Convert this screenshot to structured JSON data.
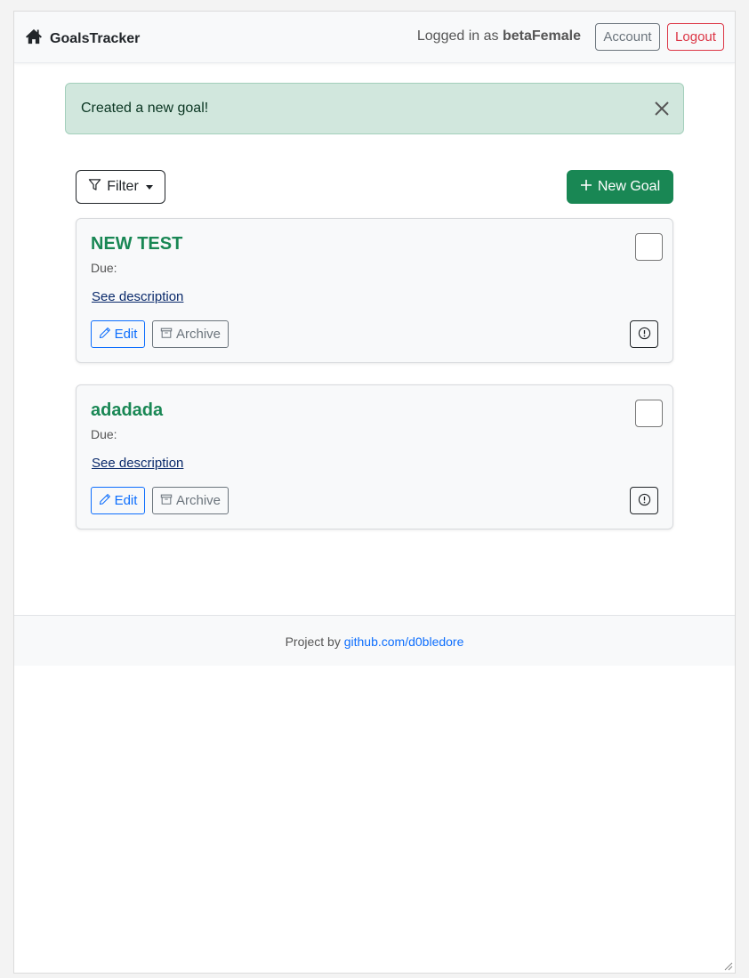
{
  "navbar": {
    "brand": "GoalsTracker",
    "logged_in_prefix": "Logged in as ",
    "username": "betaFemale",
    "account_label": "Account",
    "logout_label": "Logout"
  },
  "alert": {
    "message": "Created a new goal!"
  },
  "toolbar": {
    "filter_label": "Filter",
    "new_goal_label": "New Goal"
  },
  "goals": [
    {
      "title": "NEW TEST",
      "due_label": "Due:",
      "link_label": "See description",
      "edit_label": "Edit",
      "archive_label": "Archive"
    },
    {
      "title": "adadada",
      "due_label": "Due:",
      "link_label": "See description",
      "edit_label": "Edit",
      "archive_label": "Archive"
    }
  ],
  "footer": {
    "prefix": "Project by ",
    "link_text": "github.com/d0bledore"
  },
  "colors": {
    "success": "#198754",
    "primary": "#0d6efd",
    "danger": "#dc3545",
    "secondary": "#6c757d",
    "alert_bg": "#d1e7dd"
  },
  "icons": {
    "brand": "house-icon",
    "close": "close-icon",
    "filter": "funnel-icon",
    "new_goal": "plus-icon",
    "edit": "pencil-icon",
    "archive": "archive-icon",
    "info": "exclamation-circle-icon"
  }
}
